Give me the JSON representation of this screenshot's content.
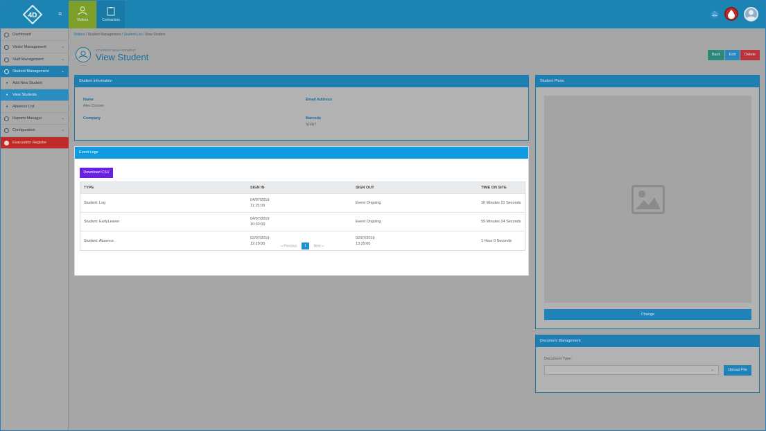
{
  "topbar": {
    "tabs": [
      {
        "label": "Visitors",
        "icon": "person-icon"
      },
      {
        "label": "Contractors",
        "icon": "clipboard-icon"
      }
    ]
  },
  "sidebar": {
    "items": [
      {
        "label": "Dashboard",
        "icon": "dashboard-icon"
      },
      {
        "label": "Visitor Management",
        "icon": "person-icon"
      },
      {
        "label": "Staff Management",
        "icon": "briefcase-icon"
      },
      {
        "label": "Student Management",
        "icon": "student-icon"
      },
      {
        "label": "Add New Student"
      },
      {
        "label": "View Students"
      },
      {
        "label": "Absence List"
      },
      {
        "label": "Reports Manager",
        "icon": "reports-icon"
      },
      {
        "label": "Configuration",
        "icon": "gear-icon"
      },
      {
        "label": "Evacuation Register",
        "icon": "fire-icon"
      }
    ]
  },
  "breadcrumb": [
    "Visitors",
    "Student Management",
    "Student List",
    "View Student"
  ],
  "page": {
    "subtitle": "STUDENT MANAGEMENT",
    "title": "View Student",
    "buttons": {
      "back": "Back",
      "edit": "Edit",
      "delete": "Delete"
    }
  },
  "student_info": {
    "title": "Student Information",
    "name_label": "Name",
    "name_value": "Alex Conner",
    "email_label": "Email Address",
    "email_value": "",
    "company_label": "Company",
    "company_value": "",
    "barcode_label": "Barcode",
    "barcode_value": "51607"
  },
  "event_logs": {
    "title": "Event Logs",
    "download_label": "Download CSV",
    "columns": [
      "TYPE",
      "SIGN IN",
      "SIGN OUT",
      "TIME ON SITE"
    ],
    "rows": [
      {
        "type": "Student: Log",
        "in_date": "04/07/2019",
        "in_time": "11:15:03",
        "out_date": "Event Ongoing",
        "out_time": "",
        "time": "16 Minutes 21 Seconds"
      },
      {
        "type": "Student: EarlyLeaver",
        "in_date": "04/07/2019",
        "in_time": "10:32:00",
        "out_date": "Event Ongoing",
        "out_time": "",
        "time": "59 Minutes 24 Seconds"
      },
      {
        "type": "Student: Absence",
        "in_date": "02/07/2019",
        "in_time": "12:29:00",
        "out_date": "02/07/2019",
        "out_time": "13:29:00",
        "time": "1 Hour 0 Seconds"
      }
    ],
    "pager": {
      "previous": "« Previous",
      "page": "1",
      "next": "Next »"
    }
  },
  "student_photo": {
    "title": "Student Photo",
    "change_label": "Change"
  },
  "documents": {
    "title": "Document Management",
    "type_label": "Document Type:",
    "upload_label": "Upload File"
  }
}
